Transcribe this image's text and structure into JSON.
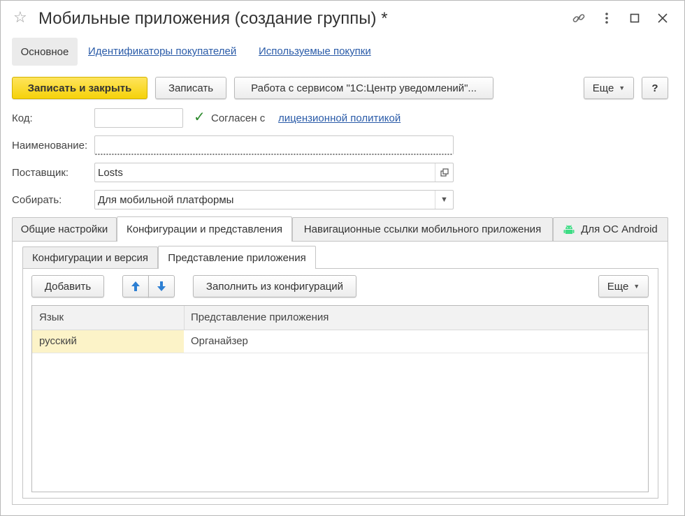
{
  "window": {
    "title": "Мобильные приложения (создание группы) *",
    "icons": [
      "star-icon",
      "link-icon",
      "more-vertical-icon",
      "maximize-icon",
      "close-icon"
    ]
  },
  "topnav": {
    "items": [
      "Основное",
      "Идентификаторы покупателей",
      "Используемые покупки"
    ]
  },
  "toolbar": {
    "save_close": "Записать и закрыть",
    "save": "Записать",
    "service": "Работа с сервисом \"1С:Центр уведомлений\"...",
    "more": "Еще",
    "help": "?"
  },
  "form": {
    "code_label": "Код:",
    "code_value": "",
    "agree_text": "Согласен с",
    "agree_link": "лицензионной политикой",
    "agree_checked": true,
    "name_label": "Наименование:",
    "name_value": "",
    "supplier_label": "Поставщик:",
    "supplier_value": "Losts",
    "collect_label": "Собирать:",
    "collect_value": "Для мобильной платформы"
  },
  "tabs": [
    "Общие настройки",
    "Конфигурации и представления",
    "Навигационные ссылки мобильного приложения",
    "Для ОС Android"
  ],
  "subtabs": [
    "Конфигурации и версия",
    "Представление приложения"
  ],
  "subtoolbar": {
    "add": "Добавить",
    "fill": "Заполнить из конфигураций",
    "more": "Еще"
  },
  "table": {
    "columns": [
      "Язык",
      "Представление приложения"
    ],
    "rows": [
      {
        "lang": "русский",
        "view": "Органайзер"
      }
    ]
  },
  "colors": {
    "primary_button": "#f5d20a",
    "link": "#2a5ba8",
    "selected_cell": "#fcf3c8",
    "arrow_blue": "#2d7fd3",
    "android_green": "#3ddc84",
    "check_green": "#2c8a2c"
  }
}
